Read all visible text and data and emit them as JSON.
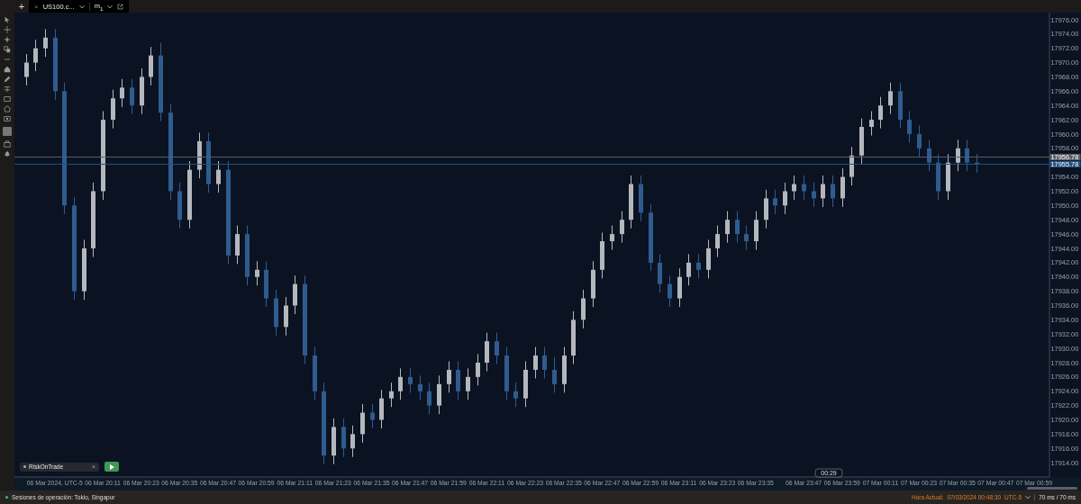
{
  "top_bar": {
    "new_tab": "+",
    "tab": {
      "close": "×",
      "symbol": "US100.c...",
      "timeframe": "m$_{1}$"
    }
  },
  "chart": {
    "crosshair_time": "00:29",
    "chart_data": {
      "type": "candlestick",
      "ylim": [
        17912,
        17977
      ],
      "yticks": [
        {
          "value": 17976,
          "label": "17976.00"
        },
        {
          "value": 17974,
          "label": "17974.00"
        },
        {
          "value": 17972,
          "label": "17972.00"
        },
        {
          "value": 17970,
          "label": "17970.00"
        },
        {
          "value": 17968,
          "label": "17968.00"
        },
        {
          "value": 17966,
          "label": "17966.00"
        },
        {
          "value": 17964,
          "label": "17964.00"
        },
        {
          "value": 17962,
          "label": "17962.00"
        },
        {
          "value": 17960,
          "label": "17960.00"
        },
        {
          "value": 17958,
          "label": "17958.00"
        },
        {
          "value": 17954,
          "label": "17954.00"
        },
        {
          "value": 17952,
          "label": "17952.00"
        },
        {
          "value": 17950,
          "label": "17950.00"
        },
        {
          "value": 17948,
          "label": "17948.00"
        },
        {
          "value": 17946,
          "label": "17946.00"
        },
        {
          "value": 17944,
          "label": "17944.00"
        },
        {
          "value": 17942,
          "label": "17942.00"
        },
        {
          "value": 17940,
          "label": "17940.00"
        },
        {
          "value": 17938,
          "label": "17938.00"
        },
        {
          "value": 17936,
          "label": "17936.00"
        },
        {
          "value": 17934,
          "label": "17934.00"
        },
        {
          "value": 17932,
          "label": "17932.00"
        },
        {
          "value": 17930,
          "label": "17930.00"
        },
        {
          "value": 17928,
          "label": "17928.00"
        },
        {
          "value": 17926,
          "label": "17926.00"
        },
        {
          "value": 17924,
          "label": "17924.00"
        },
        {
          "value": 17922,
          "label": "17922.00"
        },
        {
          "value": 17920,
          "label": "17920.00"
        },
        {
          "value": 17918,
          "label": "17918.00"
        },
        {
          "value": 17916,
          "label": "17916.00"
        },
        {
          "value": 17914,
          "label": "17914.00"
        }
      ],
      "categories": [
        null,
        null,
        null,
        "06 Mar 2024, UTC-5",
        null,
        null,
        null,
        null,
        "06 Mar 20:11",
        null,
        null,
        null,
        "06 Mar 20:23",
        null,
        null,
        null,
        "06 Mar 20:35",
        null,
        null,
        null,
        "06 Mar 20:47",
        null,
        null,
        null,
        "06 Mar 20:59",
        null,
        null,
        null,
        "06 Mar 21:11",
        null,
        null,
        null,
        "06 Mar 21:23",
        null,
        null,
        null,
        "06 Mar 21:35",
        null,
        null,
        null,
        "06 Mar 21:47",
        null,
        null,
        null,
        "06 Mar 21:59",
        null,
        null,
        null,
        "06 Mar 22:11",
        null,
        null,
        null,
        "06 Mar 22:23",
        null,
        null,
        null,
        "06 Mar 22:35",
        null,
        null,
        null,
        "06 Mar 22:47",
        null,
        null,
        null,
        "06 Mar 22:59",
        null,
        null,
        null,
        "06 Mar 23:11",
        null,
        null,
        null,
        "06 Mar 23:23",
        null,
        null,
        null,
        "06 Mar 23:35",
        null,
        null,
        null,
        null,
        "06 Mar 23:47",
        null,
        null,
        null,
        "06 Mar 23:59",
        null,
        null,
        null,
        "07 Mar 00:11",
        null,
        null,
        null,
        "07 Mar 00:23",
        null,
        null,
        null,
        "07 Mar 00:35",
        null,
        null,
        null,
        "07 Mar 00:47",
        null,
        null,
        null,
        "07 Mar 00:59",
        null
      ],
      "ohlc": [
        [
          17968,
          17971.2,
          17966.8,
          17970
        ],
        [
          17970,
          17973.2,
          17968.8,
          17972
        ],
        [
          17972,
          17974.7,
          17970.8,
          17973.5
        ],
        [
          17973.5,
          17974.7,
          17964.8,
          17966
        ],
        [
          17966,
          17967.2,
          17948.8,
          17950
        ],
        [
          17950,
          17951.2,
          17936.8,
          17938
        ],
        [
          17938,
          17945.2,
          17936.8,
          17944
        ],
        [
          17944,
          17953.2,
          17942.8,
          17952
        ],
        [
          17952,
          17963.2,
          17950.8,
          17962
        ],
        [
          17962,
          17966.2,
          17960.8,
          17965
        ],
        [
          17965,
          17967.7,
          17963.8,
          17966.5
        ],
        [
          17966.5,
          17967.7,
          17962.8,
          17964
        ],
        [
          17964,
          17969.2,
          17962.8,
          17968
        ],
        [
          17968,
          17972.2,
          17966.8,
          17971
        ],
        [
          17971,
          17972.8,
          17961.8,
          17963
        ],
        [
          17963,
          17964.2,
          17950.8,
          17952
        ],
        [
          17952,
          17953.2,
          17946.8,
          17948
        ],
        [
          17948,
          17956.2,
          17946.8,
          17955
        ],
        [
          17955,
          17960.2,
          17953.8,
          17959
        ],
        [
          17959,
          17960.2,
          17951.8,
          17953
        ],
        [
          17953,
          17956.2,
          17951.8,
          17955
        ],
        [
          17955,
          17956.2,
          17941.8,
          17943
        ],
        [
          17943,
          17947.2,
          17941.8,
          17946
        ],
        [
          17946,
          17947.2,
          17938.8,
          17940
        ],
        [
          17940,
          17942.2,
          17938.8,
          17941
        ],
        [
          17941,
          17942.2,
          17935.8,
          17937
        ],
        [
          17937,
          17938.2,
          17931.8,
          17933
        ],
        [
          17933,
          17937.2,
          17931.8,
          17936
        ],
        [
          17936,
          17940.2,
          17934.8,
          17939
        ],
        [
          17939,
          17940.2,
          17927.8,
          17929
        ],
        [
          17929,
          17930.2,
          17922.8,
          17924
        ],
        [
          17924,
          17925.2,
          17913.8,
          17915
        ],
        [
          17915,
          17920.2,
          17913.8,
          17919
        ],
        [
          17919,
          17920.2,
          17914.8,
          17916
        ],
        [
          17916,
          17919.2,
          17914.8,
          17918
        ],
        [
          17918,
          17922.2,
          17916.8,
          17921
        ],
        [
          17921,
          17922.2,
          17918.8,
          17920
        ],
        [
          17920,
          17924.2,
          17918.8,
          17923
        ],
        [
          17923,
          17925.2,
          17921.8,
          17924
        ],
        [
          17924,
          17927.2,
          17922.8,
          17926
        ],
        [
          17926,
          17927.2,
          17923.8,
          17925
        ],
        [
          17925,
          17926.2,
          17922.8,
          17924
        ],
        [
          17924,
          17925.2,
          17920.8,
          17922
        ],
        [
          17922,
          17926.2,
          17920.8,
          17925
        ],
        [
          17925,
          17928.2,
          17923.8,
          17927
        ],
        [
          17927,
          17928.2,
          17922.8,
          17924
        ],
        [
          17924,
          17927.2,
          17922.8,
          17926
        ],
        [
          17926,
          17929.2,
          17924.8,
          17928
        ],
        [
          17928,
          17932.2,
          17926.8,
          17931
        ],
        [
          17931,
          17932.2,
          17927.8,
          17929
        ],
        [
          17929,
          17930.2,
          17922.8,
          17924
        ],
        [
          17924,
          17925.2,
          17921.8,
          17923
        ],
        [
          17923,
          17928.2,
          17921.8,
          17927
        ],
        [
          17927,
          17930.2,
          17925.8,
          17929
        ],
        [
          17929,
          17930.2,
          17925.8,
          17927
        ],
        [
          17927,
          17928.8,
          17923.8,
          17925
        ],
        [
          17925,
          17930.2,
          17923.8,
          17929
        ],
        [
          17929,
          17935.2,
          17927.8,
          17934
        ],
        [
          17934,
          17938.2,
          17932.8,
          17937
        ],
        [
          17937,
          17942.2,
          17935.8,
          17941
        ],
        [
          17941,
          17946.2,
          17939.8,
          17945
        ],
        [
          17945,
          17947.2,
          17943.8,
          17946
        ],
        [
          17946,
          17949.2,
          17944.8,
          17948
        ],
        [
          17948,
          17954.2,
          17946.8,
          17953
        ],
        [
          17953,
          17954.2,
          17947.8,
          17949
        ],
        [
          17949,
          17950.2,
          17940.8,
          17942
        ],
        [
          17942,
          17943.2,
          17937.8,
          17939
        ],
        [
          17939,
          17940.2,
          17935.8,
          17937
        ],
        [
          17937,
          17941.2,
          17935.8,
          17940
        ],
        [
          17940,
          17943.2,
          17938.8,
          17942
        ],
        [
          17942,
          17943.2,
          17939.8,
          17941
        ],
        [
          17941,
          17945.2,
          17939.8,
          17944
        ],
        [
          17944,
          17947.2,
          17942.8,
          17946
        ],
        [
          17946,
          17949.2,
          17944.8,
          17948
        ],
        [
          17948,
          17949.2,
          17944.8,
          17946
        ],
        [
          17946,
          17947.2,
          17943.8,
          17945
        ],
        [
          17945,
          17949.2,
          17943.8,
          17948
        ],
        [
          17948,
          17952.2,
          17946.8,
          17951
        ],
        [
          17951,
          17952.2,
          17948.8,
          17950
        ],
        [
          17950,
          17953.2,
          17948.8,
          17952
        ],
        [
          17952,
          17954.2,
          17950.8,
          17953
        ],
        [
          17953,
          17954.2,
          17950.8,
          17952
        ],
        [
          17952,
          17953.2,
          17949.8,
          17951
        ],
        [
          17951,
          17954.2,
          17949.8,
          17953
        ],
        [
          17953,
          17954.2,
          17949.8,
          17951
        ],
        [
          17951,
          17955.2,
          17949.8,
          17954
        ],
        [
          17954,
          17958.2,
          17952.8,
          17957
        ],
        [
          17957,
          17962.2,
          17955.8,
          17961
        ],
        [
          17961,
          17963.2,
          17959.8,
          17962
        ],
        [
          17962,
          17965.2,
          17960.8,
          17964
        ],
        [
          17964,
          17967.2,
          17962.8,
          17966
        ],
        [
          17966,
          17967.2,
          17960.8,
          17962
        ],
        [
          17962,
          17963.2,
          17958.8,
          17960
        ],
        [
          17960,
          17961.2,
          17956.8,
          17958
        ],
        [
          17958,
          17959.2,
          17954.8,
          17956
        ],
        [
          17956,
          17957.2,
          17950.8,
          17952
        ],
        [
          17952,
          17957.2,
          17950.8,
          17956
        ],
        [
          17956,
          17959.2,
          17954.8,
          17958
        ],
        [
          17958,
          17959.2,
          17954.8,
          17956
        ],
        [
          17956,
          17957.2,
          17954.6,
          17955.8
        ],
        null,
        null,
        null,
        null,
        null,
        null,
        null
      ],
      "ref_lines": [
        {
          "axis": "y",
          "value": 17956.78,
          "label": "17956.78",
          "color": "#5a5f66"
        },
        {
          "axis": "y",
          "value": 17955.78,
          "label": "17955.78",
          "color": "#23507e"
        }
      ]
    },
    "strategy": {
      "name": "RiskOnTrade",
      "remove": "×"
    }
  },
  "status_bar": {
    "sessions": "Sesiones de operación: Tokio, Singapur",
    "time_label": "Hora Actual:",
    "time": "07/03/2024 00:48:30",
    "timezone": "UTC-5",
    "latency": "70 ms / 70 ms"
  }
}
